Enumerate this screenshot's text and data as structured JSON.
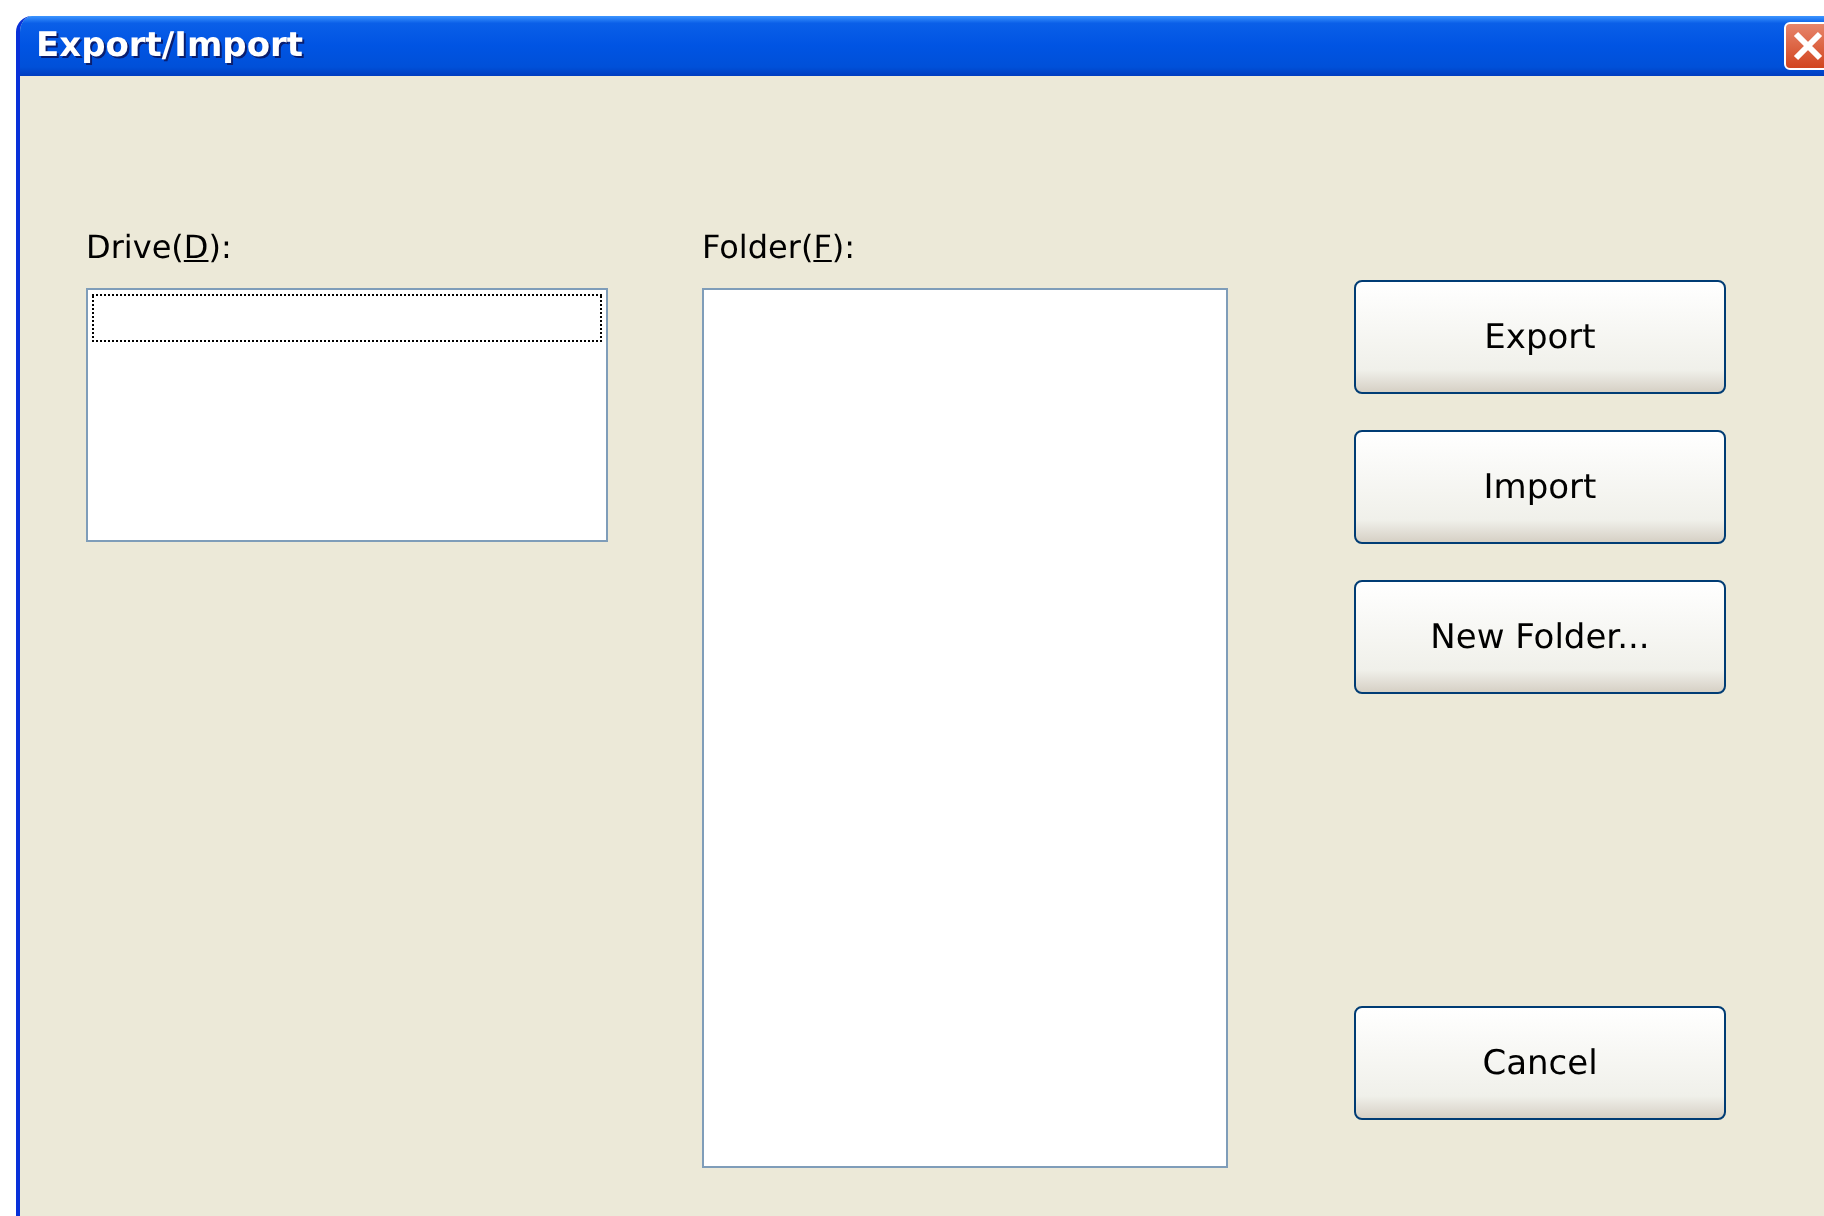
{
  "window": {
    "title": "Export/Import"
  },
  "drive_list": {
    "label_before": "Drive(",
    "mnemonic": "D",
    "label_after": "):"
  },
  "folder_list": {
    "label_before": "Folder(",
    "mnemonic": "F",
    "label_after": "):"
  },
  "buttons": [
    {
      "label": "Export"
    },
    {
      "label": "Import"
    },
    {
      "label": "New Folder..."
    }
  ],
  "cancel_button": {
    "label": "Cancel"
  }
}
